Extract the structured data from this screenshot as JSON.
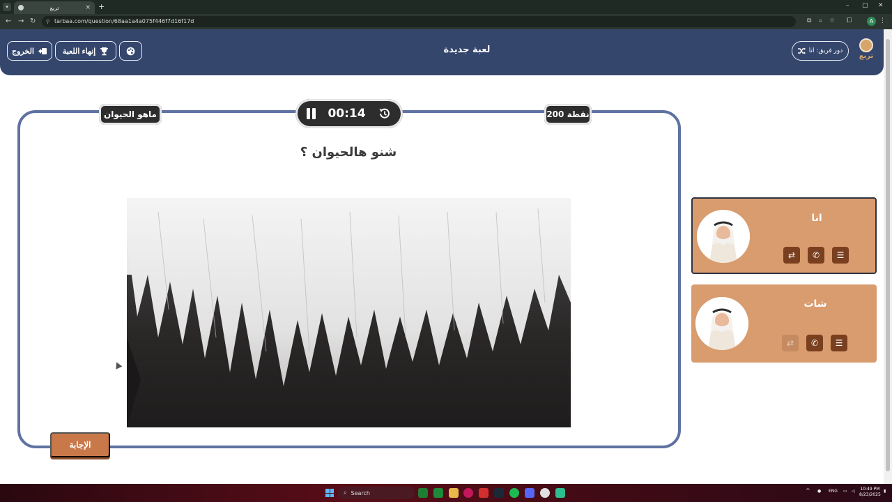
{
  "browser": {
    "tab_title": "تربع",
    "url": "tarbaa.com/question/68aa1a4a075f446f7d16f17d",
    "profile_initial": "A"
  },
  "header": {
    "exit_label": "الخروج",
    "end_game_label": "إنهاء اللعبة",
    "game_title": "لعبة جديدة",
    "team_turn_label": "دور فريق: انا",
    "logo_text": "تربع"
  },
  "question": {
    "points": "200 نقطة",
    "category": "ماهو الحيوان",
    "timer": "00:14",
    "text": "شنو هالحيوان ؟",
    "answer_button": "الإجابة"
  },
  "teams": [
    {
      "name": "انا",
      "active": true
    },
    {
      "name": "شات",
      "active": false
    }
  ],
  "taskbar": {
    "search_label": "Search",
    "language": "ENG",
    "time": "10:49 PM",
    "date": "8/23/2025"
  },
  "colors": {
    "header_bg": "#35466d",
    "card_border": "#5f72a1",
    "team_card": "#d99c6e",
    "answer_button": "#c9784a"
  }
}
